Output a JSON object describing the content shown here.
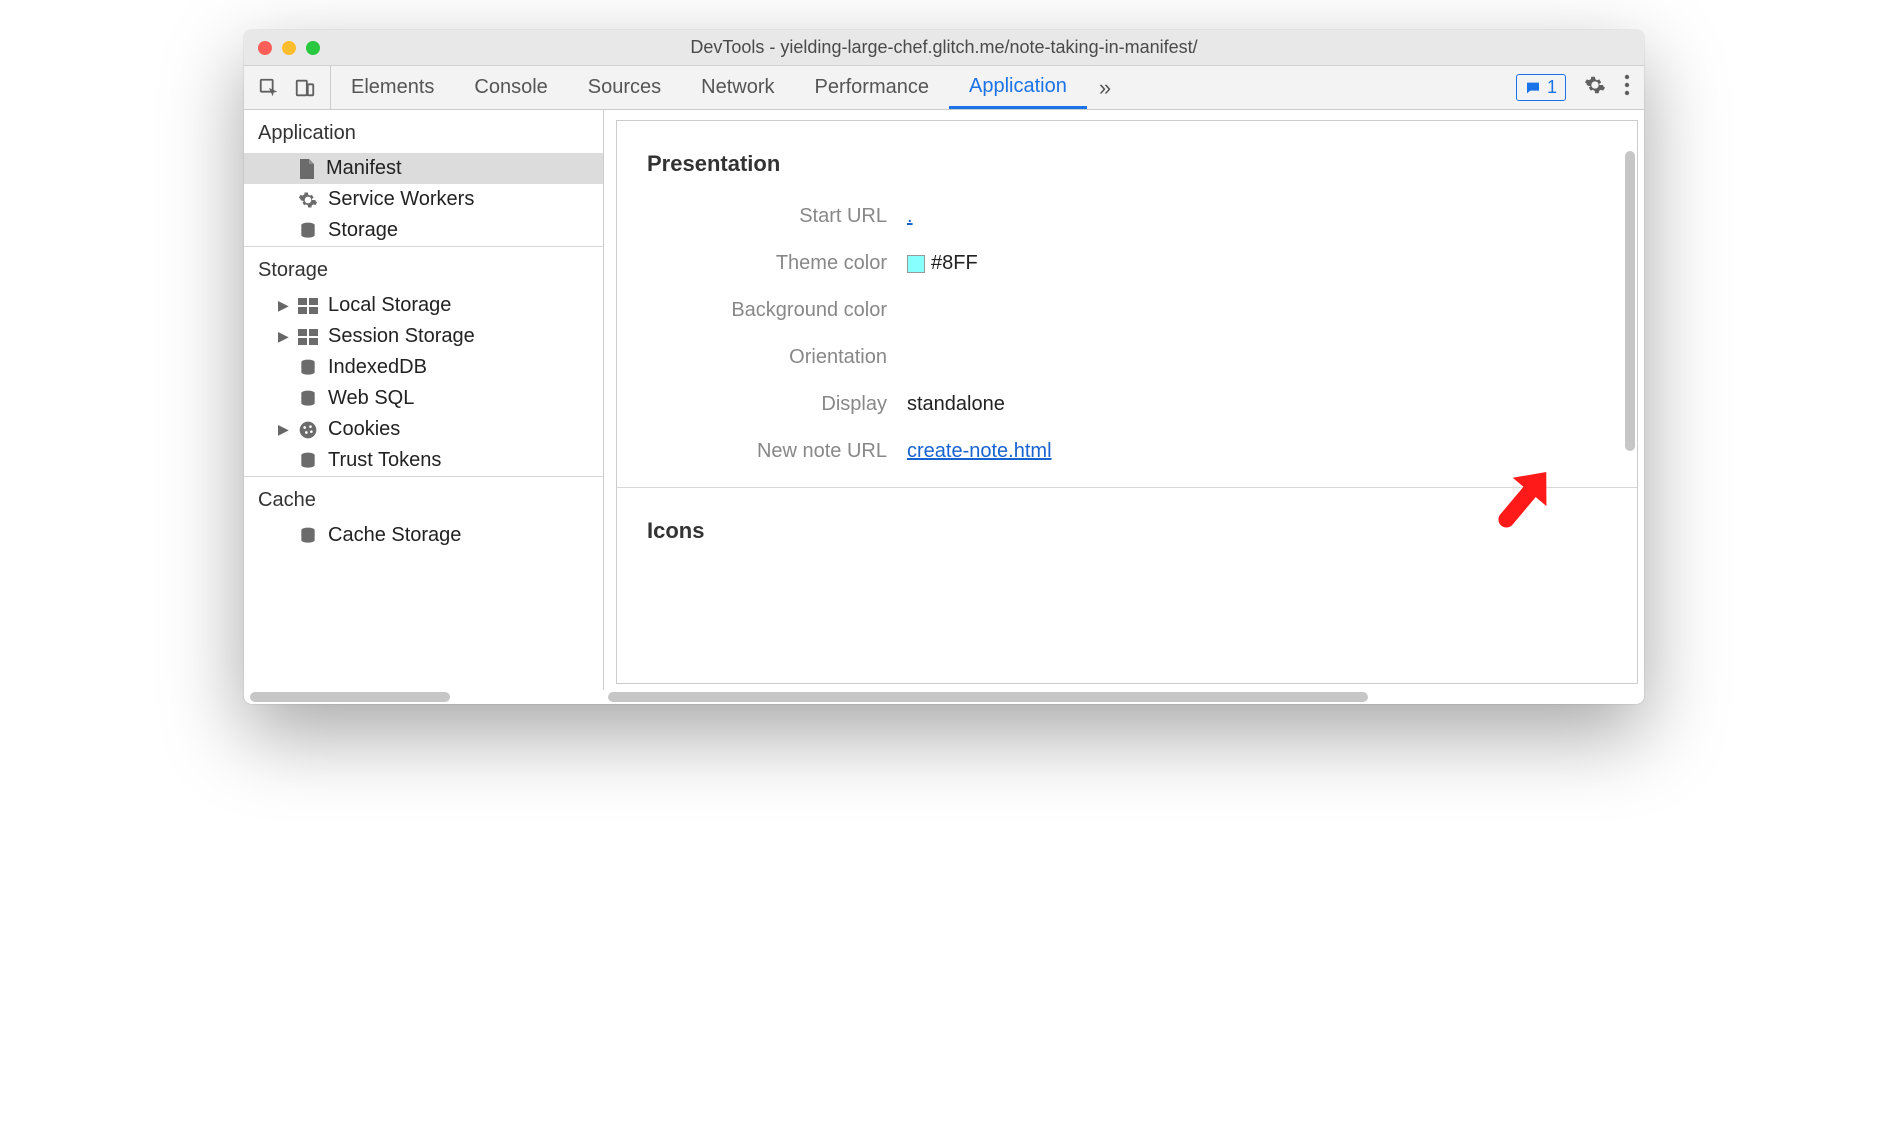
{
  "window": {
    "title": "DevTools - yielding-large-chef.glitch.me/note-taking-in-manifest/"
  },
  "tabs": {
    "items": [
      "Elements",
      "Console",
      "Sources",
      "Network",
      "Performance",
      "Application"
    ],
    "active_index": 5,
    "badge_count": "1"
  },
  "sidebar": {
    "sections": [
      {
        "title": "Application",
        "items": [
          {
            "label": "Manifest",
            "icon": "file-icon",
            "selected": true,
            "expandable": false
          },
          {
            "label": "Service Workers",
            "icon": "gear-icon",
            "selected": false,
            "expandable": false
          },
          {
            "label": "Storage",
            "icon": "db-icon",
            "selected": false,
            "expandable": false
          }
        ]
      },
      {
        "title": "Storage",
        "items": [
          {
            "label": "Local Storage",
            "icon": "grid-icon",
            "expandable": true
          },
          {
            "label": "Session Storage",
            "icon": "grid-icon",
            "expandable": true
          },
          {
            "label": "IndexedDB",
            "icon": "db-icon",
            "expandable": false
          },
          {
            "label": "Web SQL",
            "icon": "db-icon",
            "expandable": false
          },
          {
            "label": "Cookies",
            "icon": "cookie-icon",
            "expandable": true
          },
          {
            "label": "Trust Tokens",
            "icon": "db-icon",
            "expandable": false
          }
        ]
      },
      {
        "title": "Cache",
        "items": [
          {
            "label": "Cache Storage",
            "icon": "db-icon",
            "expandable": false
          }
        ]
      }
    ]
  },
  "main": {
    "presentation_title": "Presentation",
    "rows": [
      {
        "label": "Start URL",
        "value": ".",
        "link": true
      },
      {
        "label": "Theme color",
        "value": "#8FF",
        "swatch": "#88FFFF"
      },
      {
        "label": "Background color",
        "value": ""
      },
      {
        "label": "Orientation",
        "value": ""
      },
      {
        "label": "Display",
        "value": "standalone"
      },
      {
        "label": "New note URL",
        "value": "create-note.html",
        "link": true
      }
    ],
    "icons_title": "Icons"
  }
}
